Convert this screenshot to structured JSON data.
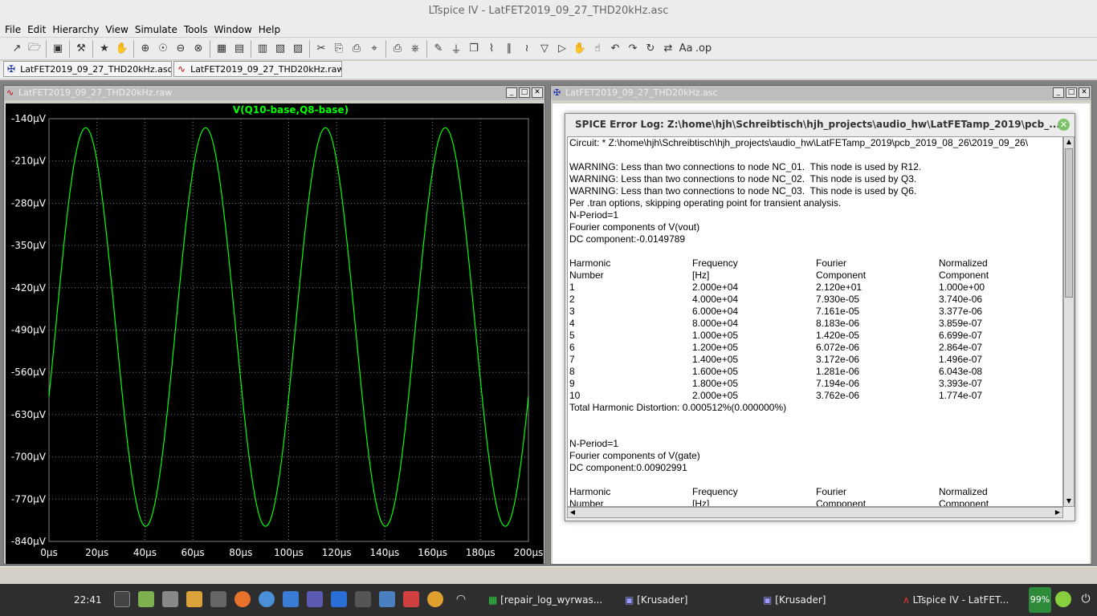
{
  "window_title": "LTspice IV - LatFET2019_09_27_THD20kHz.asc",
  "menu": [
    "File",
    "Edit",
    "Hierarchy",
    "View",
    "Simulate",
    "Tools",
    "Window",
    "Help"
  ],
  "tabs": [
    {
      "label": "LatFET2019_09_27_THD20kHz.asc",
      "icon": "schematic-icon"
    },
    {
      "label": "LatFET2019_09_27_THD20kHz.raw",
      "icon": "waveform-icon"
    }
  ],
  "plot_window": {
    "title": "LatFET2019_09_27_THD20kHz.raw",
    "trace_label": "V(Q10-base,Q8-base)",
    "trace_color": "#00ff00"
  },
  "chart_data": {
    "type": "line",
    "title": "V(Q10-base,Q8-base)",
    "x_ticks": [
      "0µs",
      "20µs",
      "40µs",
      "60µs",
      "80µs",
      "100µs",
      "120µs",
      "140µs",
      "160µs",
      "180µs",
      "200µs"
    ],
    "y_ticks": [
      "-140µV",
      "-210µV",
      "-280µV",
      "-350µV",
      "-420µV",
      "-490µV",
      "-560µV",
      "-630µV",
      "-700µV",
      "-770µV",
      "-840µV"
    ],
    "xlim": [
      0,
      200
    ],
    "ylim": [
      -840,
      -140
    ],
    "x_unit": "µs",
    "y_unit": "µV",
    "series": [
      {
        "name": "V(Q10-base,Q8-base)",
        "frequency_khz": 20,
        "max": -155,
        "min": -815,
        "start": -600,
        "color": "#00ff00"
      }
    ]
  },
  "schematic_window": {
    "title": "LatFET2019_09_27_THD20kHz.asc"
  },
  "error_log": {
    "title": "SPICE Error Log: Z:\\home\\hjh\\Schreibtisch\\hjh_projects\\audio_hw\\LatFETamp_2019\\pcb_...",
    "lines": [
      "Circuit: * Z:\\home\\hjh\\Schreibtisch\\hjh_projects\\audio_hw\\LatFETamp_2019\\pcb_2019_08_26\\2019_09_26\\",
      "",
      "WARNING: Less than two connections to node NC_01.  This node is used by R12.",
      "WARNING: Less than two connections to node NC_02.  This node is used by Q3.",
      "WARNING: Less than two connections to node NC_03.  This node is used by Q6.",
      "Per .tran options, skipping operating point for transient analysis.",
      "N-Period=1",
      "Fourier components of V(vout)",
      "DC component:-0.0149789"
    ],
    "table_headers": [
      [
        "Harmonic",
        "Frequency",
        "Fourier",
        "Normalized"
      ],
      [
        " Number",
        "[Hz]",
        "Component",
        "Component"
      ]
    ],
    "table_rows": [
      [
        "1",
        "2.000e+04",
        "2.120e+01",
        "1.000e+00"
      ],
      [
        "2",
        "4.000e+04",
        "7.930e-05",
        "3.740e-06"
      ],
      [
        "3",
        "6.000e+04",
        "7.161e-05",
        "3.377e-06"
      ],
      [
        "4",
        "8.000e+04",
        "8.183e-06",
        "3.859e-07"
      ],
      [
        "5",
        "1.000e+05",
        "1.420e-05",
        "6.699e-07"
      ],
      [
        "6",
        "1.200e+05",
        "6.072e-06",
        "2.864e-07"
      ],
      [
        "7",
        "1.400e+05",
        "3.172e-06",
        "1.496e-07"
      ],
      [
        "8",
        "1.600e+05",
        "1.281e-06",
        "6.043e-08"
      ],
      [
        "9",
        "1.800e+05",
        "7.194e-06",
        "3.393e-07"
      ],
      [
        "10",
        "2.000e+05",
        "3.762e-06",
        "1.774e-07"
      ]
    ],
    "thd": "Total Harmonic Distortion: 0.000512%(0.000000%)",
    "lines2": [
      "N-Period=1",
      "Fourier components of V(gate)",
      "DC component:0.00902991"
    ],
    "table2_headers": [
      [
        "Harmonic",
        "Frequency",
        "Fourier",
        "Normalized"
      ],
      [
        " Number",
        "[Hz]",
        "Component",
        "Component"
      ]
    ]
  },
  "taskbar": {
    "clock": "22:41",
    "items": [
      "[repair_log_wyrwas...",
      "[Krusader]",
      "[Krusader]",
      "LTspice IV - LatFET..."
    ],
    "battery": "99%"
  }
}
